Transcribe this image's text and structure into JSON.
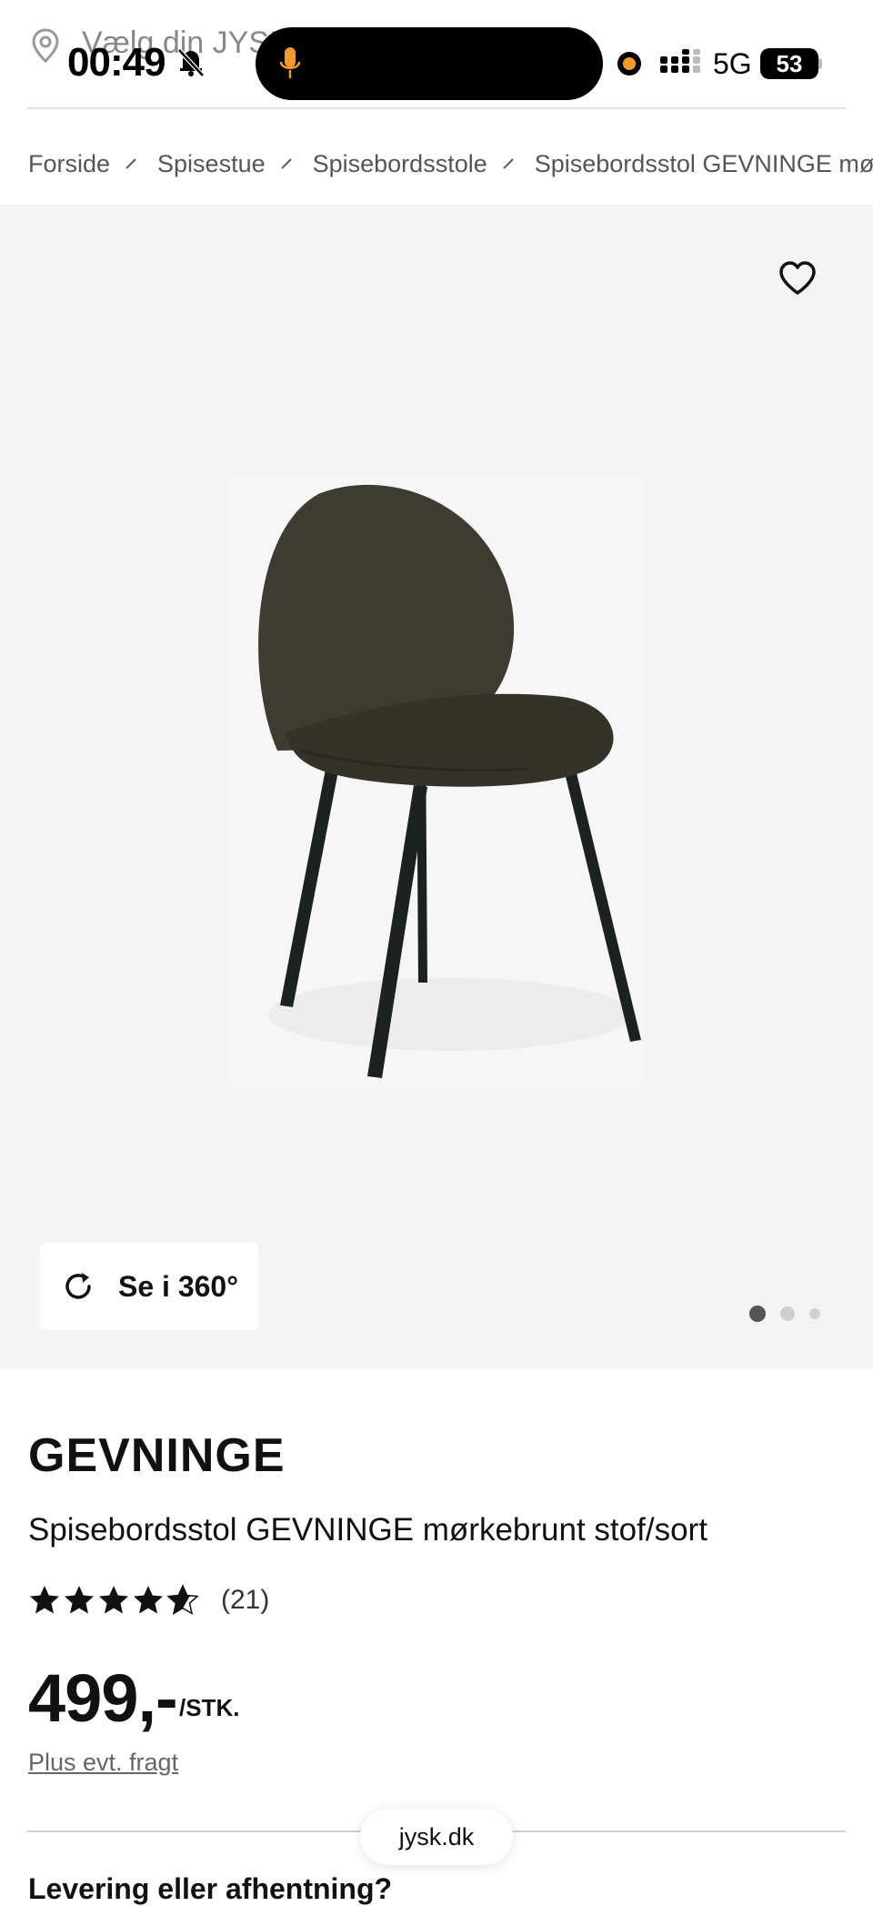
{
  "status_bar": {
    "store_prompt": "Vælg din JYSK",
    "time": "00:49",
    "network": "5G",
    "battery": "53"
  },
  "breadcrumb": [
    "Forside",
    "Spisestue",
    "Spisebordsstole",
    "Spisebordsstol GEVNINGE mørkebrunt stof/sort"
  ],
  "gallery": {
    "view_360_label": "Se i 360°",
    "image_count": 3,
    "active_index": 0
  },
  "product": {
    "brand": "GEVNINGE",
    "name": "Spisebordsstol GEVNINGE mørkebrunt stof/sort",
    "rating": 4.5,
    "review_count": "(21)",
    "price": "499,-",
    "unit": "/STK.",
    "freight_link": "Plus evt. fragt"
  },
  "section": {
    "delivery_heading": "Levering eller afhentning?"
  },
  "browser": {
    "url": "jysk.dk"
  },
  "colors": {
    "gallery_bg": "#f4f4f4",
    "text": "#111111",
    "recording_dot": "#f39a2b",
    "mic": "#f39a2b"
  }
}
